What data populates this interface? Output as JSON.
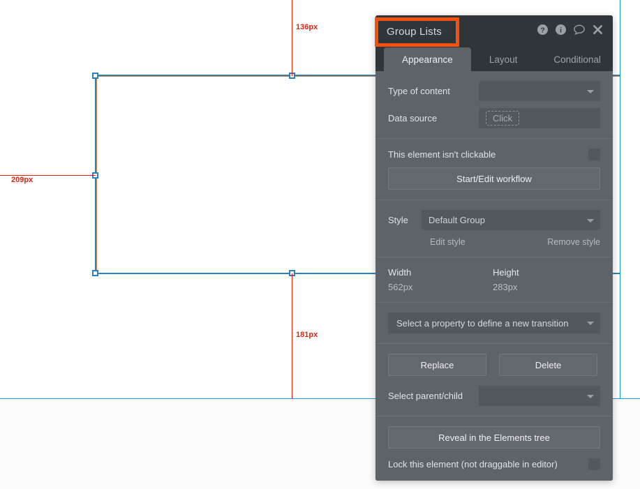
{
  "canvas": {
    "measurements": [
      {
        "name": "top-distance",
        "value": "136px"
      },
      {
        "name": "left-distance",
        "value": "209px"
      },
      {
        "name": "bottom-distance",
        "value": "181px"
      }
    ]
  },
  "panel": {
    "title": "Group Lists",
    "highlight_color": "#f4510f",
    "header_icons": [
      {
        "name": "help-icon",
        "glyph": "?"
      },
      {
        "name": "info-icon",
        "glyph": "i"
      },
      {
        "name": "comment-icon",
        "glyph": "speech-bubble"
      },
      {
        "name": "close-icon",
        "glyph": "x"
      }
    ],
    "tabs": [
      {
        "label": "Appearance",
        "active": true
      },
      {
        "label": "Layout",
        "active": false
      },
      {
        "label": "Conditional",
        "active": false
      }
    ],
    "appearance": {
      "type_of_content": {
        "label": "Type of content",
        "value": ""
      },
      "data_source": {
        "label": "Data source",
        "value": "",
        "placeholder": "Click"
      },
      "clickable": {
        "label": "This element isn't clickable",
        "checked": false
      },
      "workflow_button": "Start/Edit workflow",
      "style": {
        "label": "Style",
        "value": "Default Group",
        "edit_link": "Edit style",
        "remove_link": "Remove style"
      },
      "dimensions": {
        "width_label": "Width",
        "width_value": "562px",
        "height_label": "Height",
        "height_value": "283px"
      },
      "transition": {
        "placeholder": "Select a property to define a new transition"
      },
      "replace_button": "Replace",
      "delete_button": "Delete",
      "parent_child": {
        "label": "Select parent/child",
        "value": ""
      },
      "reveal_button": "Reveal in the Elements tree",
      "lock": {
        "label": "Lock this element (not draggable in editor)",
        "checked": false
      }
    }
  }
}
